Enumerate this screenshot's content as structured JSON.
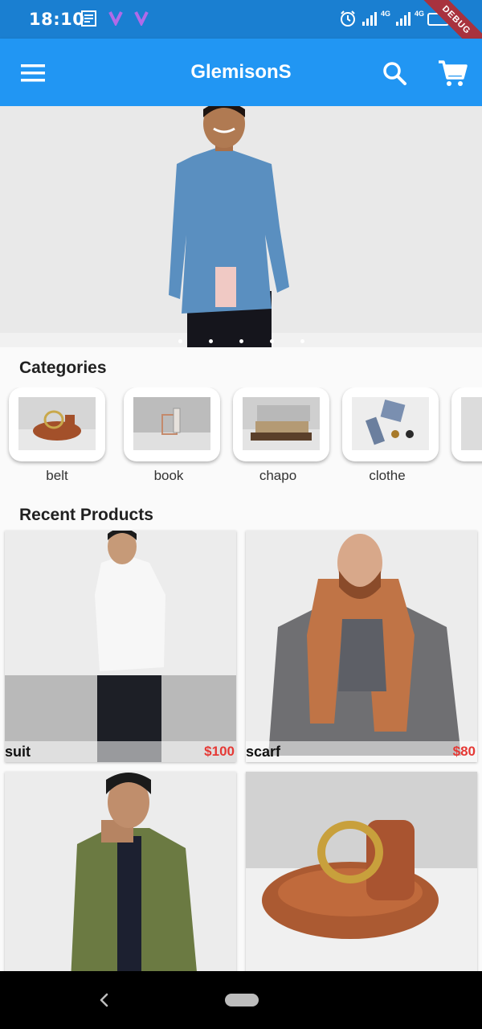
{
  "status_bar": {
    "time": "18:10",
    "network1": "4G",
    "network2": "4G",
    "debug_label": "DEBUG"
  },
  "app_bar": {
    "title": "GlemisonS"
  },
  "icons": {
    "menu": "menu-icon",
    "search": "search-icon",
    "cart": "cart-icon",
    "back": "back-icon"
  },
  "carousel": {
    "dot_count": 5
  },
  "categories": {
    "title": "Categories",
    "items": [
      {
        "label": "belt"
      },
      {
        "label": "book"
      },
      {
        "label": "chapo"
      },
      {
        "label": "clothe"
      }
    ]
  },
  "recent_products": {
    "title": "Recent Products",
    "items": [
      {
        "name": "suit",
        "price": "$100"
      },
      {
        "name": "scarf",
        "price": "$80"
      },
      {
        "name": "",
        "price": ""
      },
      {
        "name": "",
        "price": ""
      }
    ]
  },
  "colors": {
    "primary": "#2196f3",
    "status_bar": "#1a7fd1",
    "price": "#e53935"
  }
}
